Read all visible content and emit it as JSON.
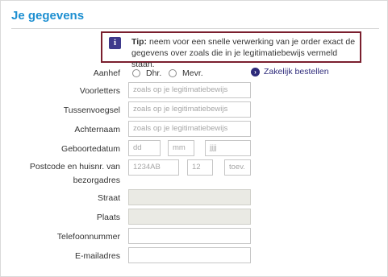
{
  "section_title": "Je gegevens",
  "tip": {
    "icon": "info-icon",
    "label": "Tip:",
    "text": " neem voor een snelle verwerking van je order exact de gegevens over zoals die in je legitimatiebewijs vermeld staan.",
    "border_color": "#7a1f2e"
  },
  "form": {
    "aanhef": {
      "label": "Aanhef",
      "options": [
        "Dhr.",
        "Mevr."
      ]
    },
    "zakelijk_link": "Zakelijk bestellen",
    "voorletters": {
      "label": "Voorletters",
      "placeholder": "zoals op je legitimatiebewijs"
    },
    "tussenvoegsel": {
      "label": "Tussenvoegsel",
      "placeholder": "zoals op je legitimatiebewijs"
    },
    "achternaam": {
      "label": "Achternaam",
      "placeholder": "zoals op je legitimatiebewijs"
    },
    "geboortedatum": {
      "label": "Geboortedatum",
      "day": "dd",
      "month": "mm",
      "year": "jjjj"
    },
    "postcode": {
      "label": "Postcode en huisnr. van bezorgadres",
      "postcode": "1234AB",
      "huisnr": "12",
      "toevoeging": "toev."
    },
    "straat": {
      "label": "Straat"
    },
    "plaats": {
      "label": "Plaats"
    },
    "telefoon": {
      "label": "Telefoonnummer"
    },
    "email": {
      "label": "E-mailadres"
    }
  },
  "colors": {
    "title": "#1d8fd1",
    "link": "#2d2a7a",
    "tip_icon": "#3e3a8c"
  }
}
